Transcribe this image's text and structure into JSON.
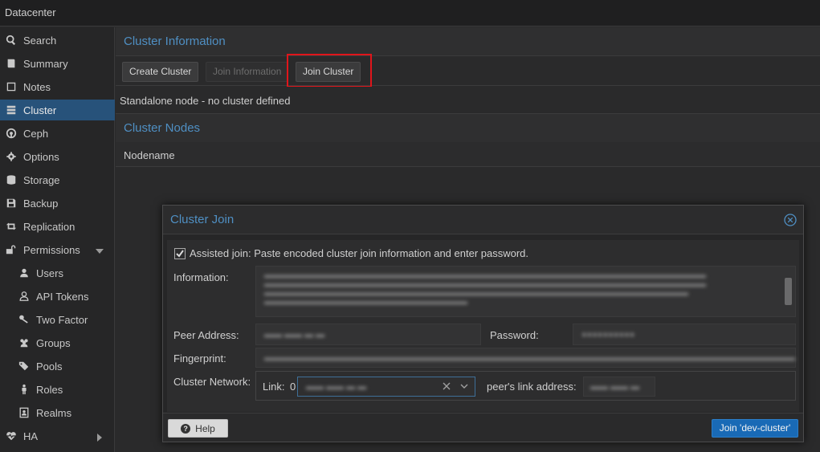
{
  "topbar": {
    "title": "Datacenter"
  },
  "sidebar": {
    "items": [
      {
        "label": "Search",
        "icon": "search-icon"
      },
      {
        "label": "Summary",
        "icon": "book-icon"
      },
      {
        "label": "Notes",
        "icon": "notes-icon"
      },
      {
        "label": "Cluster",
        "icon": "server-icon",
        "active": true
      },
      {
        "label": "Ceph",
        "icon": "ceph-icon"
      },
      {
        "label": "Options",
        "icon": "gear-icon"
      },
      {
        "label": "Storage",
        "icon": "database-icon"
      },
      {
        "label": "Backup",
        "icon": "floppy-icon"
      },
      {
        "label": "Replication",
        "icon": "retweet-icon"
      },
      {
        "label": "Permissions",
        "icon": "unlock-icon"
      },
      {
        "label": "Users",
        "icon": "user-icon"
      },
      {
        "label": "API Tokens",
        "icon": "user-outline-icon"
      },
      {
        "label": "Two Factor",
        "icon": "key-icon"
      },
      {
        "label": "Groups",
        "icon": "users-icon"
      },
      {
        "label": "Pools",
        "icon": "tags-icon"
      },
      {
        "label": "Roles",
        "icon": "male-icon"
      },
      {
        "label": "Realms",
        "icon": "address-book-icon"
      },
      {
        "label": "HA",
        "icon": "heartbeat-icon"
      }
    ]
  },
  "main": {
    "cluster_info_title": "Cluster Information",
    "buttons": {
      "create_cluster": "Create Cluster",
      "join_information": "Join Information",
      "join_cluster": "Join Cluster"
    },
    "status_text": "Standalone node - no cluster defined",
    "cluster_nodes_title": "Cluster Nodes",
    "nodes_column": "Nodename"
  },
  "dialog": {
    "title": "Cluster Join",
    "assisted_join_label": "Assisted join: Paste encoded cluster join information and enter password.",
    "assisted_join_checked": true,
    "information_label": "Information:",
    "peer_address_label": "Peer Address:",
    "password_label": "Password:",
    "fingerprint_label": "Fingerprint:",
    "cluster_network_label": "Cluster Network:",
    "link_label": "Link:",
    "link_number": "0",
    "peer_link_label": "peer's link address:",
    "help_button": "Help",
    "join_button": "Join 'dev-cluster'"
  },
  "colors": {
    "accent": "#4f8fc3",
    "active_nav": "#27527a",
    "highlight_box": "#e0151b",
    "primary_button": "#196ab6"
  }
}
